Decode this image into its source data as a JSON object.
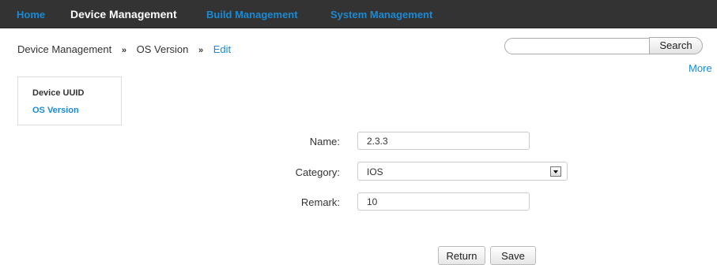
{
  "topnav": {
    "items": [
      {
        "label": "Home",
        "active": false
      },
      {
        "label": "Device Management",
        "active": true
      },
      {
        "label": "Build Management",
        "active": false
      },
      {
        "label": "System Management",
        "active": false
      }
    ]
  },
  "breadcrumb": {
    "items": [
      "Device Management",
      "OS Version",
      "Edit"
    ],
    "separator": "»"
  },
  "search": {
    "placeholder": "",
    "value": "",
    "button_label": "Search"
  },
  "more_link": "More",
  "sidebar": {
    "items": [
      {
        "label": "Device UUID",
        "active": false
      },
      {
        "label": "OS Version",
        "active": true
      }
    ]
  },
  "form": {
    "name": {
      "label": "Name:",
      "value": "2.3.3"
    },
    "category": {
      "label": "Category:",
      "value": "IOS",
      "icon": "chevron-down-icon"
    },
    "remark": {
      "label": "Remark:",
      "value": "10"
    }
  },
  "actions": {
    "return_label": "Return",
    "save_label": "Save"
  },
  "colors": {
    "nav_background": "#333333",
    "link_blue": "#1b8ad3",
    "active_nav": "#ffffff"
  }
}
